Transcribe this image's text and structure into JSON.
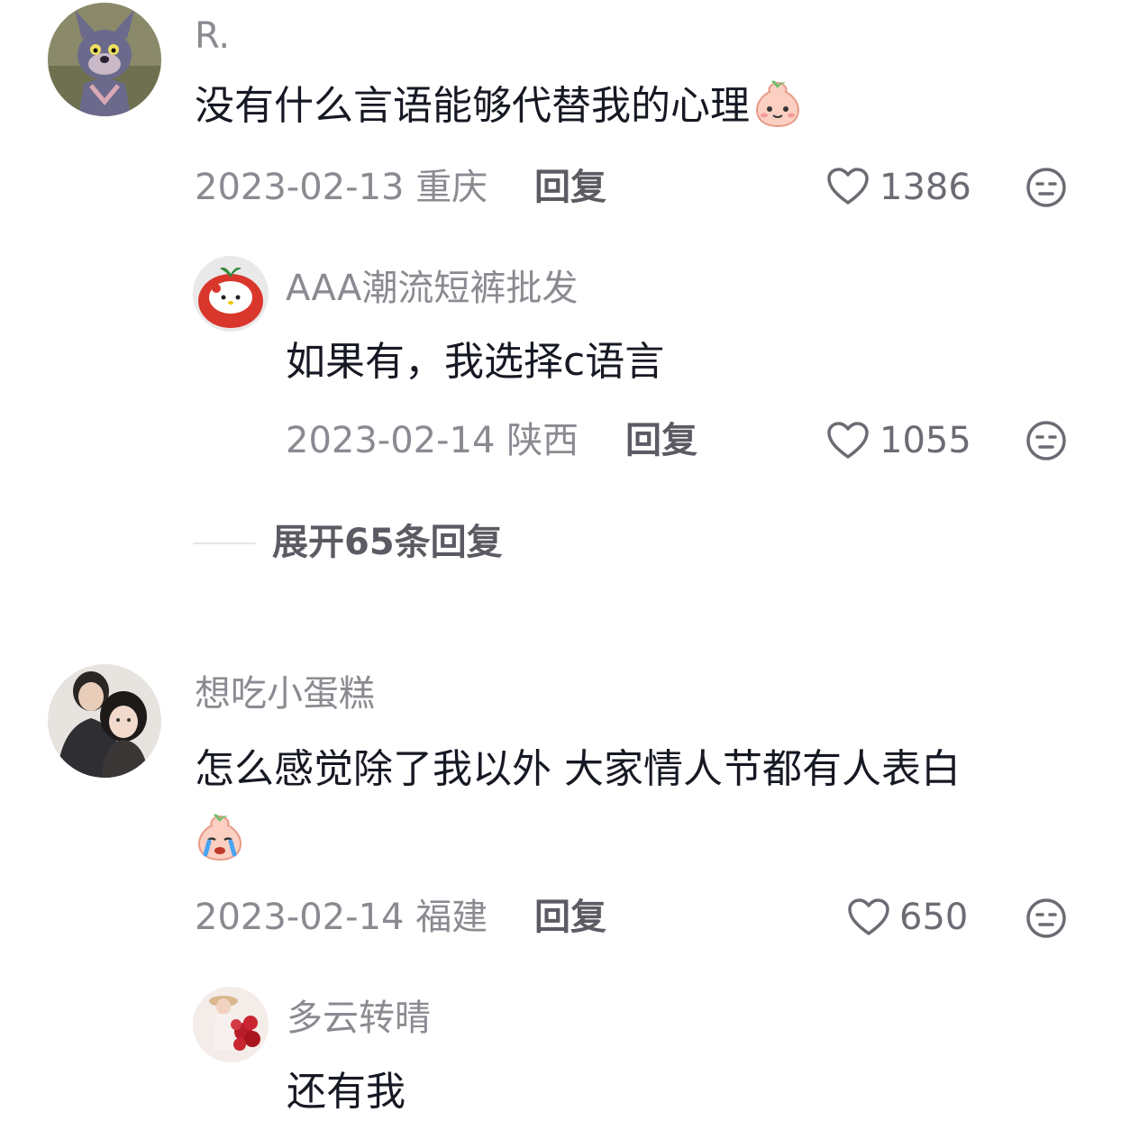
{
  "comments": [
    {
      "username": "R.",
      "text": "没有什么言语能够代替我的心理",
      "emoji_icon": "smiling-peach-emoji",
      "date": "2023-02-13",
      "location": "重庆",
      "reply_label": "回复",
      "likes": "1386",
      "avatar_icon": "cartoon-cat-avatar"
    },
    {
      "username": "想吃小蛋糕",
      "text": "怎么感觉除了我以外 大家情人节都有人表白",
      "emoji_icon": "crying-peach-emoji",
      "date": "2023-02-14",
      "location": "福建",
      "reply_label": "回复",
      "likes": "650",
      "avatar_icon": "couple-photo-avatar"
    }
  ],
  "replies": [
    {
      "username": "AAA潮流短裤批发",
      "text": "如果有，我选择c语言",
      "date": "2023-02-14",
      "location": "陕西",
      "reply_label": "回复",
      "likes": "1055",
      "avatar_icon": "hello-kitty-avatar"
    },
    {
      "username": "多云转晴",
      "text": "还有我",
      "avatar_icon": "girl-with-roses-avatar"
    }
  ],
  "expand": {
    "label": "展开65条回复"
  },
  "icons": {
    "like": "heart-outline-icon",
    "dislike": "unamused-face-icon"
  },
  "colors": {
    "secondary_text": "#8a8b91",
    "primary_text": "#161823"
  }
}
